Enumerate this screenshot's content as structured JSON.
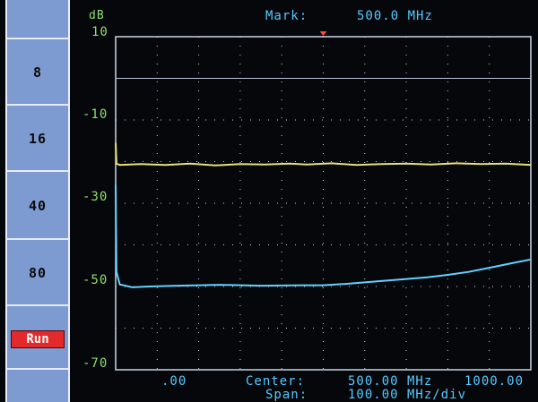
{
  "sidebar": {
    "items": [
      "8",
      "16",
      "40",
      "80"
    ],
    "run_label": "Run"
  },
  "header": {
    "unit": "dB",
    "mark_label": "Mark:",
    "mark_value": "500.0 MHz"
  },
  "footer": {
    "left_value": ".00",
    "center_label": "Center:",
    "center_value": "500.00 MHz",
    "right_value": "1000.00",
    "span_label": "Span:",
    "span_value": "100.00 MHz/div"
  },
  "colors": {
    "sidebar": "#7d9ad1",
    "run_button": "#e22a2a",
    "trace_yellow": "#e8e07a",
    "trace_cyan": "#63d2ff",
    "grid": "#c9d6e6",
    "label_green": "#8be06c",
    "label_cyan": "#56c9ff"
  },
  "chart_data": {
    "type": "line",
    "title": "",
    "xlabel": "",
    "ylabel": "dB",
    "xlim": [
      0,
      1000
    ],
    "ylim": [
      -70,
      10
    ],
    "x_divisions": 10,
    "y_divisions": 8,
    "y_ticks": [
      "10",
      "-10",
      "-30",
      "-50",
      "-70"
    ],
    "marker_x": 500,
    "reference_level": 0,
    "series": [
      {
        "color": "#e8e07a",
        "x": [
          0,
          2,
          10,
          60,
          120,
          180,
          240,
          300,
          360,
          420,
          460,
          520,
          580,
          640,
          700,
          760,
          820,
          880,
          940,
          1000
        ],
        "y": [
          -15.5,
          -20.5,
          -20.8,
          -20.6,
          -20.8,
          -20.5,
          -20.9,
          -20.6,
          -20.7,
          -20.5,
          -20.7,
          -20.4,
          -20.8,
          -20.6,
          -20.5,
          -20.7,
          -20.4,
          -20.6,
          -20.5,
          -20.8
        ]
      },
      {
        "color": "#63d2ff",
        "x": [
          0,
          2,
          10,
          40,
          80,
          150,
          250,
          350,
          450,
          500,
          550,
          600,
          650,
          700,
          750,
          800,
          850,
          900,
          950,
          1000
        ],
        "y": [
          -25.5,
          -46.5,
          -49.5,
          -50.2,
          -50.0,
          -49.8,
          -49.6,
          -49.8,
          -49.7,
          -49.7,
          -49.4,
          -49.0,
          -48.6,
          -48.2,
          -47.8,
          -47.2,
          -46.5,
          -45.5,
          -44.5,
          -43.5
        ]
      }
    ]
  }
}
